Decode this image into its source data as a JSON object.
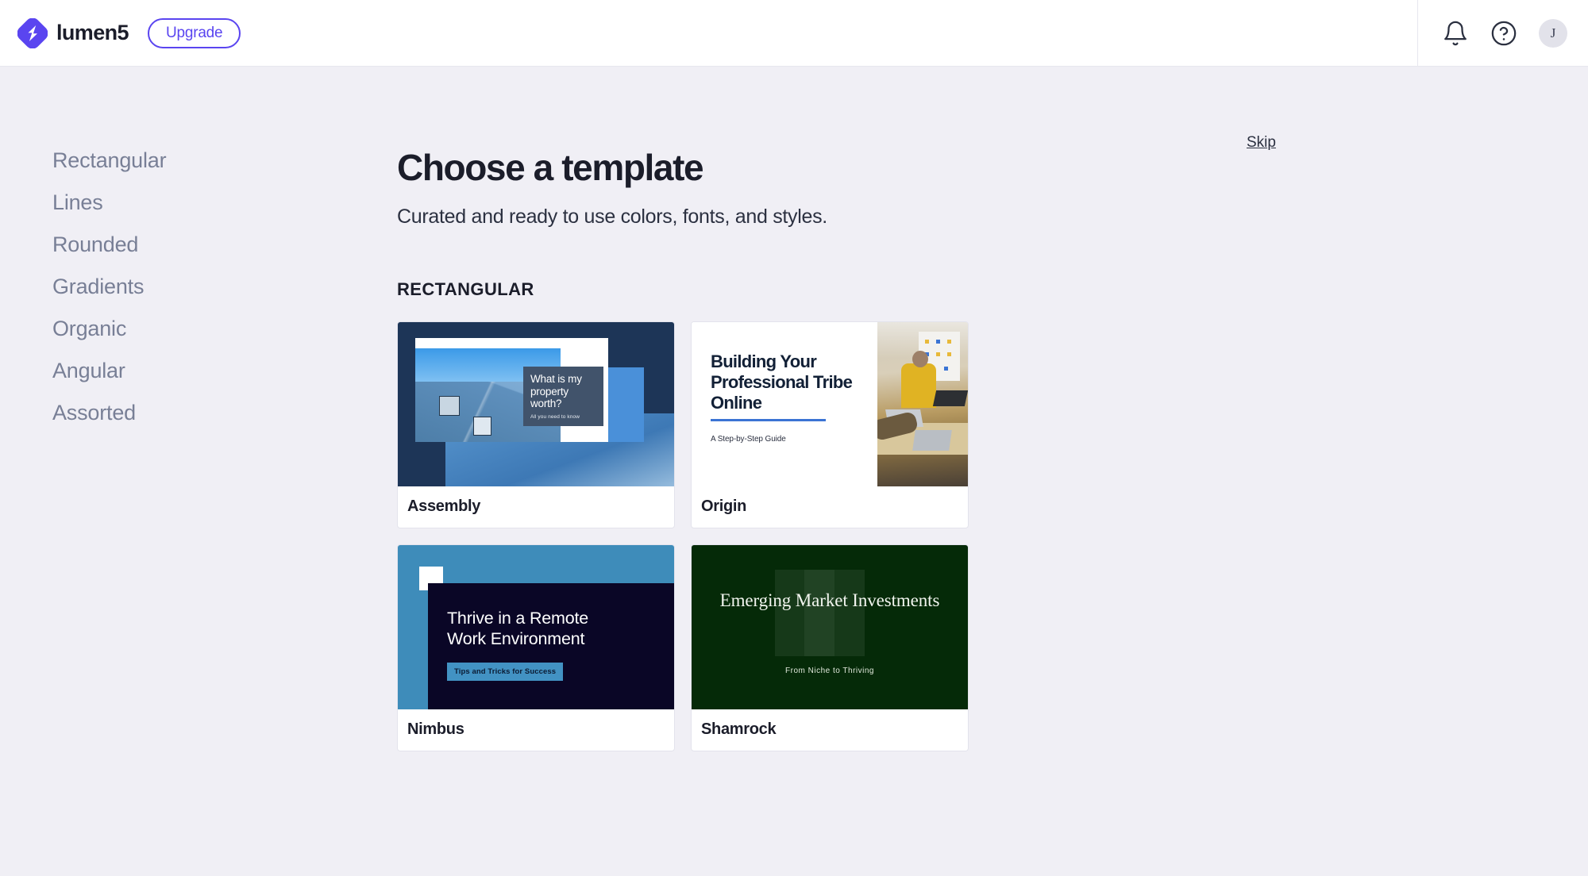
{
  "header": {
    "brand_name": "lumen5",
    "logo_icon": "lumen5-logo-icon",
    "upgrade_label": "Upgrade",
    "notifications_icon": "bell-icon",
    "help_icon": "help-circle-icon",
    "avatar_initial": "J",
    "accent_color": "#5a45f0"
  },
  "sidebar": {
    "items": [
      {
        "label": "Rectangular"
      },
      {
        "label": "Lines"
      },
      {
        "label": "Rounded"
      },
      {
        "label": "Gradients"
      },
      {
        "label": "Organic"
      },
      {
        "label": "Angular"
      },
      {
        "label": "Assorted"
      }
    ]
  },
  "main": {
    "title": "Choose a template",
    "subtitle": "Curated and ready to use colors, fonts, and styles.",
    "skip_label": "Skip",
    "section_label": "RECTANGULAR",
    "templates": [
      {
        "name": "Assembly",
        "headline": "What is my property worth?",
        "subhead": "All you need to know",
        "bg_color": "#1d3557"
      },
      {
        "name": "Origin",
        "headline": "Building Your Professional Tribe Online",
        "subhead": "A Step-by-Step Guide",
        "bg_color": "#ffffff",
        "rule_color": "#3b74d4"
      },
      {
        "name": "Nimbus",
        "headline": "Thrive in a Remote Work Environment",
        "subhead": "Tips and Tricks for Success",
        "bg_color": "#3e8cba",
        "panel_color": "#0a0626"
      },
      {
        "name": "Shamrock",
        "headline": "Emerging Market Investments",
        "subhead": "From Niche to Thriving",
        "bg_color": "#052a08"
      }
    ]
  }
}
